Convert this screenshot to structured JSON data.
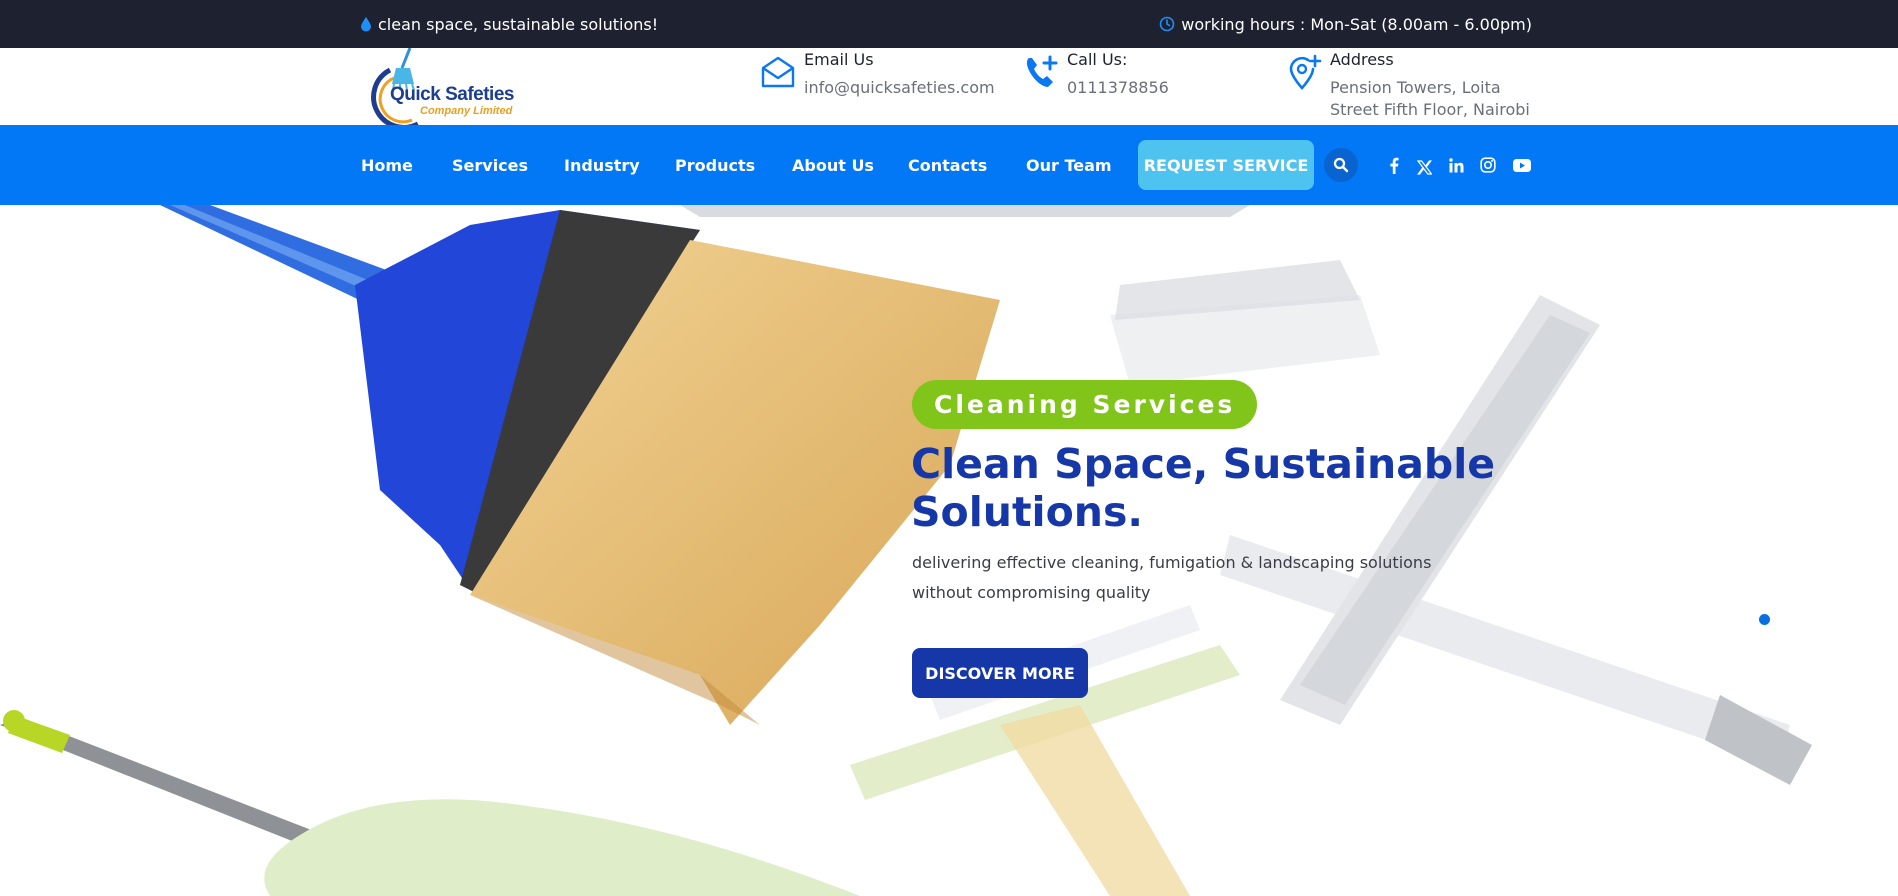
{
  "topbar": {
    "tagline": "clean space, sustainable solutions!",
    "hours": "working hours : Mon-Sat (8.00am - 6.00pm)",
    "icons": {
      "tagline": "water-drop-icon",
      "hours": "clock-icon"
    }
  },
  "logo": {
    "name_line1": "Quick Safeties",
    "name_line2": "Company Limited"
  },
  "contact": {
    "email": {
      "title": "Email Us",
      "value": "info@quicksafeties.com",
      "icon": "envelope-icon"
    },
    "phone": {
      "title": "Call Us:",
      "value": "0111378856",
      "icon": "phone-plus-icon"
    },
    "address": {
      "title": "Address",
      "line1": "Pension Towers, Loita",
      "line2": "Street Fifth Floor, Nairobi",
      "icon": "location-pin-plus-icon"
    }
  },
  "nav": {
    "items": [
      {
        "label": "Home"
      },
      {
        "label": "Services"
      },
      {
        "label": "Industry"
      },
      {
        "label": "Products"
      },
      {
        "label": "About Us"
      },
      {
        "label": "Contacts"
      },
      {
        "label": "Our Team"
      }
    ],
    "cta": "REQUEST SERVICE",
    "social": [
      "facebook-icon",
      "x-twitter-icon",
      "linkedin-icon",
      "instagram-icon",
      "youtube-icon"
    ]
  },
  "hero": {
    "badge": "Cleaning Services",
    "title": "Clean Space, Sustainable Solutions.",
    "description": "delivering effective cleaning, fumigation & landscaping solutions without compromising quality",
    "button": "DISCOVER MORE",
    "active_slide": 1
  },
  "colors": {
    "topbar_bg": "#1e2130",
    "nav_bg": "#0278f7",
    "request_button": "#4ec3f0",
    "badge_green": "#81c41a",
    "title_blue": "#1637a8"
  }
}
